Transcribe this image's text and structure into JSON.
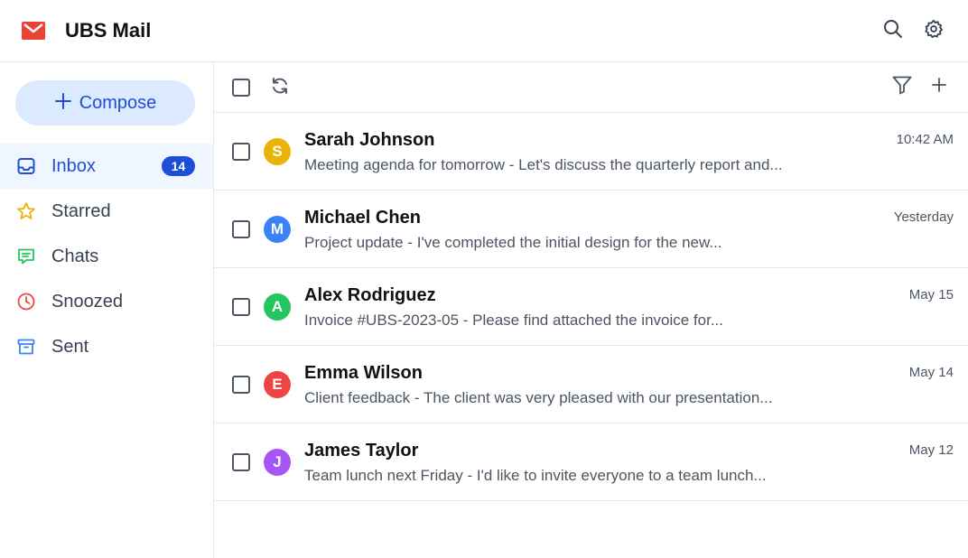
{
  "app": {
    "title": "UBS Mail",
    "logo_icon": "mail-envelope-icon",
    "brand_color": "#EA4335"
  },
  "header": {
    "search_icon": "search-icon",
    "settings_icon": "gear-icon"
  },
  "sidebar": {
    "compose_label": "Compose",
    "items": [
      {
        "id": "inbox",
        "label": "Inbox",
        "icon": "inbox-icon",
        "badge": "14",
        "active": true,
        "color": "#1d4ed8"
      },
      {
        "id": "starred",
        "label": "Starred",
        "icon": "star-icon",
        "color": "#eab308"
      },
      {
        "id": "chats",
        "label": "Chats",
        "icon": "chat-icon",
        "color": "#22c55e"
      },
      {
        "id": "snoozed",
        "label": "Snoozed",
        "icon": "clock-icon",
        "color": "#ef4444"
      },
      {
        "id": "sent",
        "label": "Sent",
        "icon": "archive-box-icon",
        "color": "#3b82f6"
      }
    ]
  },
  "toolbar": {
    "select_all_icon": "checkbox-icon",
    "refresh_icon": "refresh-icon",
    "filter_icon": "filter-icon",
    "add_icon": "plus-icon"
  },
  "emails": [
    {
      "initial": "S",
      "avatar_color": "#eab308",
      "sender": "Sarah Johnson",
      "snippet": "Meeting agenda for tomorrow - Let's discuss the quarterly report and...",
      "time": "10:42 AM"
    },
    {
      "initial": "M",
      "avatar_color": "#3b82f6",
      "sender": "Michael Chen",
      "snippet": "Project update - I've completed the initial design for the new...",
      "time": "Yesterday"
    },
    {
      "initial": "A",
      "avatar_color": "#22c55e",
      "sender": "Alex Rodriguez",
      "snippet": "Invoice #UBS-2023-05 - Please find attached the invoice for...",
      "time": "May 15"
    },
    {
      "initial": "E",
      "avatar_color": "#ef4444",
      "sender": "Emma Wilson",
      "snippet": "Client feedback - The client was very pleased with our presentation...",
      "time": "May 14"
    },
    {
      "initial": "J",
      "avatar_color": "#a855f7",
      "sender": "James Taylor",
      "snippet": "Team lunch next Friday - I'd like to invite everyone to a team lunch...",
      "time": "May 12"
    }
  ]
}
